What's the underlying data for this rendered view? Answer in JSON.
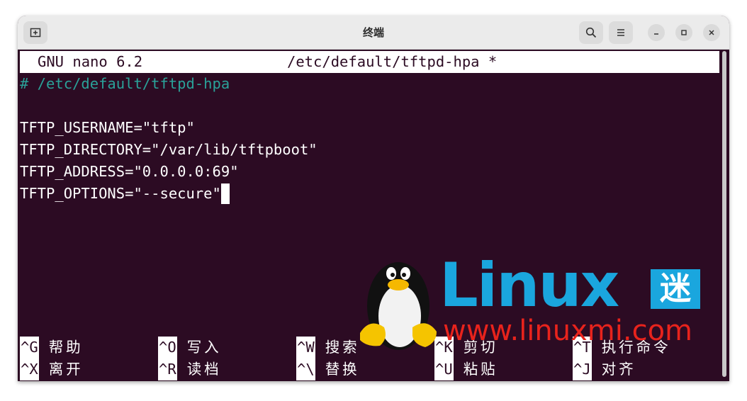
{
  "window": {
    "title": "终端"
  },
  "nano": {
    "header_left": "GNU nano 6.2",
    "header_file": "/etc/default/tftpd-hpa *",
    "lines": [
      "# /etc/default/tftpd-hpa",
      "",
      "TFTP_USERNAME=\"tftp\"",
      "TFTP_DIRECTORY=\"/var/lib/tftpboot\"",
      "TFTP_ADDRESS=\"0.0.0.0:69\"",
      "TFTP_OPTIONS=\"--secure\""
    ],
    "shortcuts_row1": [
      {
        "key": "^G",
        "label": "帮助"
      },
      {
        "key": "^O",
        "label": "写入"
      },
      {
        "key": "^W",
        "label": "搜索"
      },
      {
        "key": "^K",
        "label": "剪切"
      },
      {
        "key": "^T",
        "label": "执行命令"
      }
    ],
    "shortcuts_row2": [
      {
        "key": "^X",
        "label": "离开"
      },
      {
        "key": "^R",
        "label": "读档"
      },
      {
        "key": "^\\",
        "label": "替换"
      },
      {
        "key": "^U",
        "label": "粘贴"
      },
      {
        "key": "^J",
        "label": "对齐"
      }
    ]
  },
  "watermark": {
    "brand": "Linux",
    "brand_suffix": "迷",
    "url": "www.linuxmi.com"
  },
  "colors": {
    "terminal_bg": "#2c0b23",
    "comment": "#2aa198",
    "watermark_blue": "#1aa6de",
    "watermark_red": "#e8231c"
  }
}
